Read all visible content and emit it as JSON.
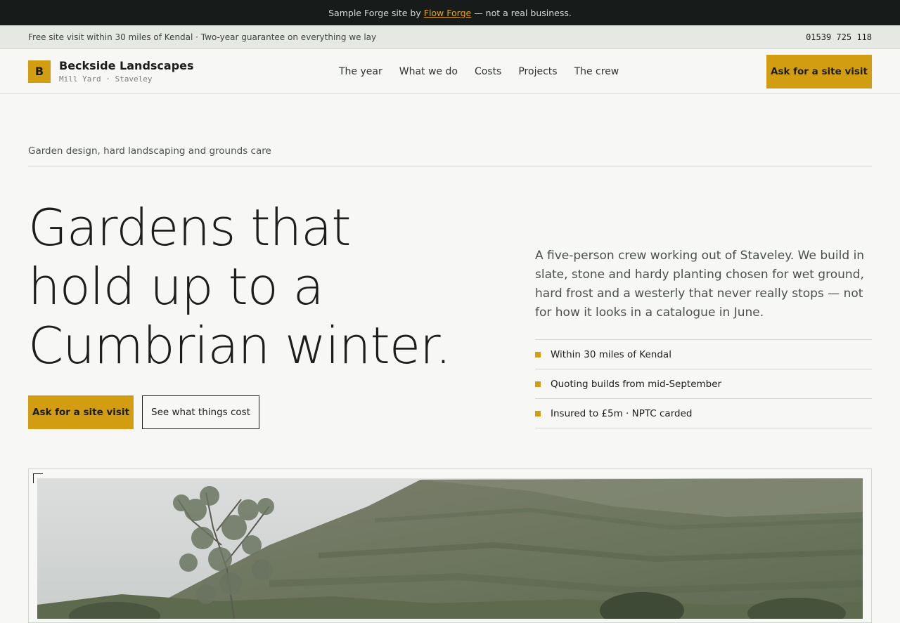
{
  "demo_banner": {
    "prefix": "Sample Forge site by",
    "link": "Flow Forge",
    "suffix": "— not a real business."
  },
  "info_strip": {
    "text": "Free site visit within 30 miles of Kendal · Two-year guarantee on everything we lay",
    "phone": "01539 725 118"
  },
  "header": {
    "logo_letter": "B",
    "name": "Beckside Landscapes",
    "location": "Mill Yard · Staveley",
    "nav": [
      "The year",
      "What we do",
      "Costs",
      "Projects",
      "The crew"
    ],
    "cta": "Ask for a site visit"
  },
  "hero": {
    "eyebrow": "Garden design, hard landscaping and grounds care",
    "title_lines": [
      "Gardens that",
      "hold up to a",
      "Cumbrian winter."
    ],
    "primary_cta": "Ask for a site visit",
    "secondary_cta": "See what things cost",
    "lede": "A five-person crew working out of Staveley. We build in slate, stone and hardy planting chosen for wet ground, hard frost and a westerly that never really stops — not for how it looks in a catalogue in June.",
    "facts": [
      "Within 30 miles of Kendal",
      "Quoting builds from mid-September",
      "Insured to £5m · NPTC carded"
    ]
  },
  "colors": {
    "accent": "#d39d12",
    "ink": "#1b1e1d",
    "background": "#f7f7f5",
    "demo_bar": "#171c1b"
  },
  "photo": {
    "icon": "landscape-photo"
  }
}
